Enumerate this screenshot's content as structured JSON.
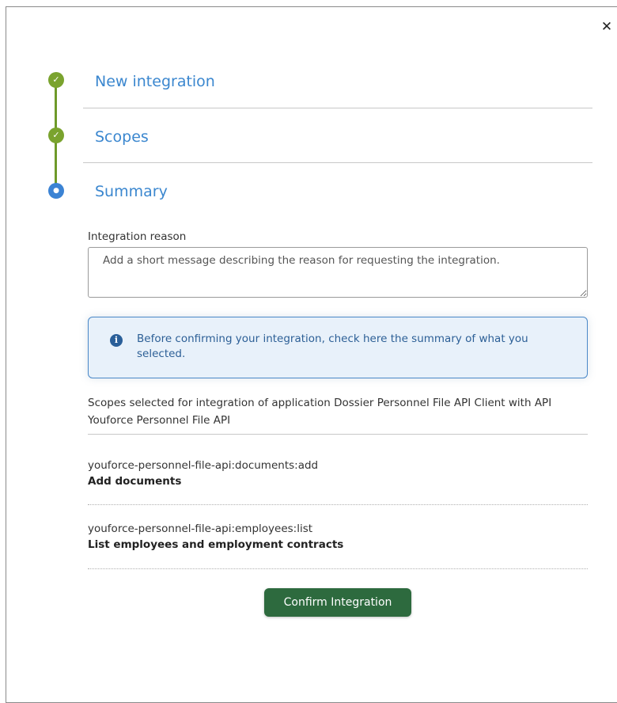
{
  "dialog": {
    "close_icon": "close-icon"
  },
  "steps": [
    {
      "title": "New integration",
      "state": "done"
    },
    {
      "title": "Scopes",
      "state": "done"
    },
    {
      "title": "Summary",
      "state": "active"
    }
  ],
  "summary": {
    "reason_label": "Integration reason",
    "reason_placeholder": "Add a short message describing the reason for requesting the integration.",
    "reason_value": "",
    "info_icon": "info-icon",
    "info_text": "Before confirming your integration, check here the summary of what you selected.",
    "scopes_intro": "Scopes selected for integration of application Dossier Personnel File API Client with API Youforce Personnel File API",
    "scopes": [
      {
        "id": "youforce-personnel-file-api:documents:add",
        "description": "Add documents"
      },
      {
        "id": "youforce-personnel-file-api:employees:list",
        "description": "List employees and employment contracts"
      }
    ],
    "confirm_label": "Confirm Integration"
  },
  "colors": {
    "step_done": "#7aa32e",
    "step_active": "#3b83d4",
    "step_title": "#3b87cf",
    "info_bg": "#e8f1fa",
    "info_border": "#4a88c8",
    "confirm_bg": "#2d6a3e"
  }
}
